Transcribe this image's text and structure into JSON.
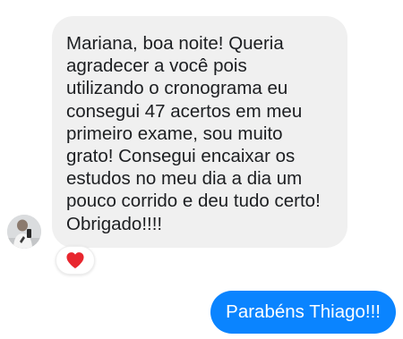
{
  "incoming_message": {
    "lines": [
      "Mariana, boa noite! Queria",
      "agradecer a você pois",
      "utilizando o cronograma eu",
      "consegui 47 acertos em meu",
      "primeiro exame, sou muito",
      "grato! Consegui encaixar os",
      "estudos no meu dia a dia um",
      "pouco corrido e deu tudo certo!",
      "Obrigado!!!!"
    ],
    "bubble_color": "#f0f0f0",
    "text_color": "#1c1e21",
    "reaction_icon": "heart-icon",
    "reaction_color": "#e8262e"
  },
  "outgoing_message": {
    "text": "Parabéns Thiago!!!",
    "bubble_color": "#0a84ff",
    "text_color": "#ffffff"
  },
  "sender": {
    "avatar_icon": "user-photo-avatar"
  }
}
